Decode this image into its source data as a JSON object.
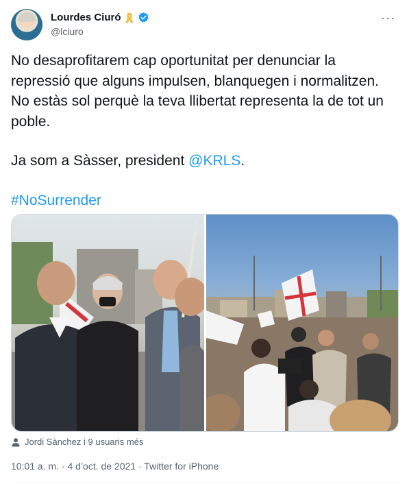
{
  "author": {
    "name": "Lourdes Ciuró",
    "handle": "@lciuro",
    "ribbon_icon": "yellow-ribbon-icon",
    "verified_icon": "verified-badge-icon"
  },
  "more_menu": "···",
  "tweet": {
    "paragraph1": "No desaprofitarem cap oportunitat per denunciar la repressió que alguns impulsen, blanquegen i normalitzen. No estàs sol perquè la teva llibertat representa la de tot un poble.",
    "paragraph2_prefix": "Ja som a Sàsser, president ",
    "mention": "@KRLS",
    "paragraph2_suffix": ".",
    "hashtag": "#NoSurrender"
  },
  "tagged_people": "Jordi Sànchez i 9 usuaris més",
  "meta": "10:01 a. m. · 4 d’oct. de 2021 · Twitter for iPhone",
  "colors": {
    "link": "#1d9bf0",
    "verified": "#1d9bf0",
    "ribbon": "#f2c94c",
    "muted_text": "#536471"
  }
}
